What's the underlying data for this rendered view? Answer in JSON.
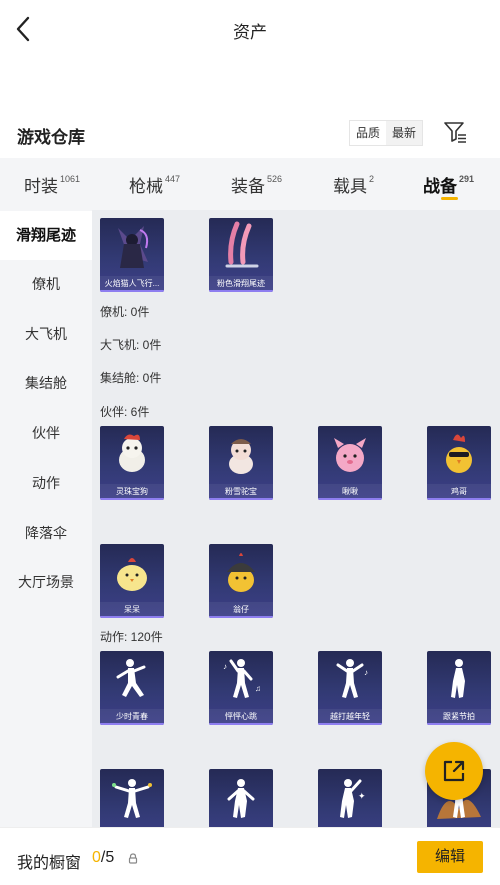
{
  "header": {
    "title": "资产"
  },
  "warehouse": {
    "title": "游戏仓库",
    "sort_options": [
      "品质",
      "最新"
    ],
    "selected_sort": "品质",
    "filter_icon": "filter-icon"
  },
  "tabs": [
    {
      "label": "时装",
      "count": "1061"
    },
    {
      "label": "枪械",
      "count": "447"
    },
    {
      "label": "装备",
      "count": "526"
    },
    {
      "label": "载具",
      "count": "2"
    },
    {
      "label": "战备",
      "count": "291"
    }
  ],
  "active_tab": "战备",
  "sidebar": {
    "items": [
      "滑翔尾迹",
      "僚机",
      "大飞机",
      "集结舱",
      "伙伴",
      "动作",
      "降落伞",
      "大厅场景"
    ],
    "active": "滑翔尾迹"
  },
  "sections": {
    "trail_items": [
      "火焰猫人飞行...",
      "粉色滑翔尾迹"
    ],
    "wingman_label": "僚机: 0件",
    "plane_label": "大飞机: 0件",
    "pod_label": "集结舱: 0件",
    "partner_label": "伙伴: 6件",
    "partner_items": [
      "灵珠宝狗",
      "粉雪驼宝",
      "啾啾",
      "鸡哥",
      "呆呆",
      "翁仔"
    ],
    "emote_label": "动作: 120件",
    "emote_items": [
      "少时青春",
      "怦怦心跳",
      "越打越年轻",
      "跟紧节拍"
    ]
  },
  "bottom": {
    "label": "我的橱窗",
    "used": "0",
    "total": "/5",
    "edit_label": "编辑"
  },
  "colors": {
    "accent": "#f5b400",
    "card_bg": "#2e3468",
    "content_bg": "#ebedf0"
  }
}
